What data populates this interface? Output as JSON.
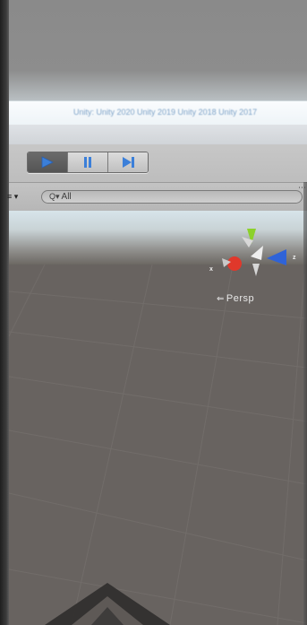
{
  "notice": {
    "text": "Unity: Unity 2020 Unity 2019 Unity 2018 Unity 2017"
  },
  "playmode": {
    "play_icon": "play-icon",
    "pause_icon": "pause-icon",
    "step_icon": "step-icon",
    "accent": "#3b7fd9"
  },
  "scene_header": {
    "dropdown_stub": "≡ ▾",
    "search_glyph": "Q▾",
    "search_value": "All",
    "more_icon": "more-dots-icon"
  },
  "scene": {
    "projection_label": "Persp",
    "x_axis_label": "x",
    "z_axis_label": "z",
    "colors": {
      "x_axis": "#e0382b",
      "y_axis": "#8cd12a",
      "z_axis": "#2f63d8",
      "ground": "#686360"
    }
  }
}
